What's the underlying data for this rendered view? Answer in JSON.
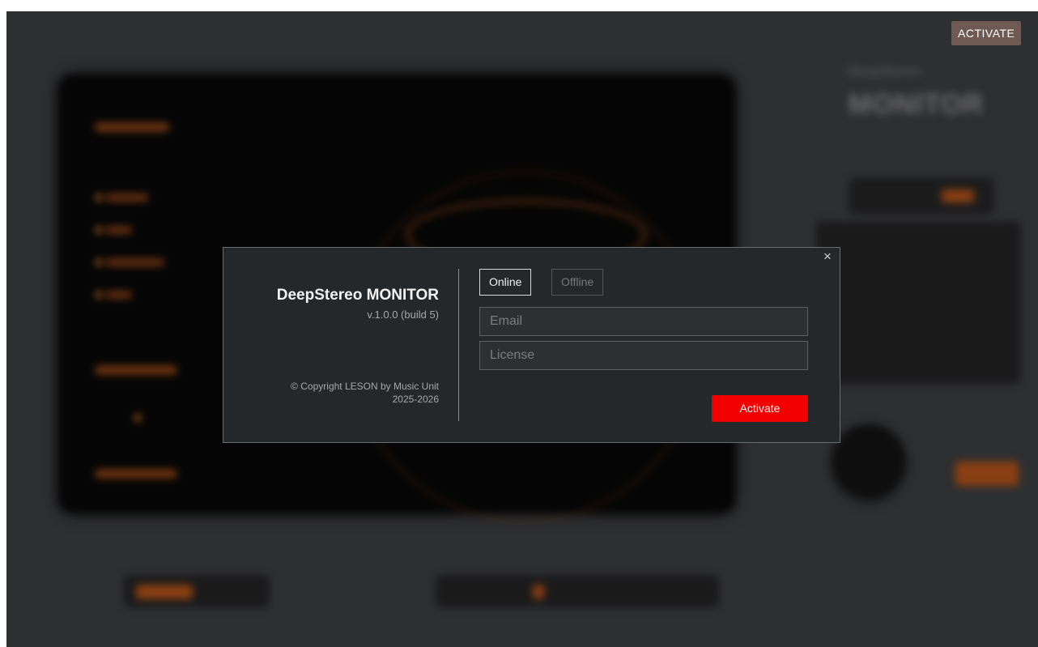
{
  "header": {
    "activate_label": "ACTIVATE"
  },
  "background_plugin": {
    "brand_small": "DeepStereo",
    "brand_big": "MONITOR"
  },
  "modal": {
    "close_icon": "×",
    "product_name": "DeepStereo MONITOR",
    "version": "v.1.0.0 (build 5)",
    "copyright_line1": "© Copyright LESON by Music Unit",
    "copyright_line2": "2025-2026",
    "tabs": [
      {
        "label": "Online",
        "selected": true
      },
      {
        "label": "Offline",
        "selected": false
      }
    ],
    "email": {
      "value": "",
      "placeholder": "Email"
    },
    "license": {
      "value": "",
      "placeholder": "License"
    },
    "activate_label": "Activate"
  },
  "colors": {
    "accent_red": "#f20000",
    "modal_bg": "#25282a",
    "corner_button_bg": "#6e5a52"
  }
}
